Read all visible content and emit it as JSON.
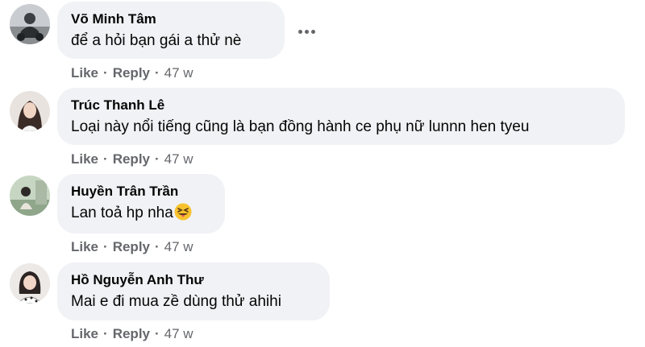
{
  "comments": [
    {
      "author": "Võ Minh Tâm",
      "text": "để a hỏi bạn gái a thử nè",
      "like": "Like",
      "reply": "Reply",
      "sep": "·",
      "time": "47 w",
      "avatar_icon": "avatar-photo-motorbike"
    },
    {
      "author": "Trúc Thanh Lê",
      "text": "Loại này nổi tiếng cũng là bạn đồng hành ce phụ nữ lunnn hen tyeu",
      "like": "Like",
      "reply": "Reply",
      "sep": "·",
      "time": "47 w",
      "avatar_icon": "avatar-photo-woman"
    },
    {
      "author": "Huyền Trân Trần",
      "text": "Lan toả hp nha",
      "emoji": "squinting-face-with-tongue-emoji",
      "like": "Like",
      "reply": "Reply",
      "sep": "·",
      "time": "47 w",
      "avatar_icon": "avatar-photo-outdoor"
    },
    {
      "author": "Hồ Nguyễn Anh Thư",
      "text": "Mai e đi mua zề dùng thử ahihi",
      "like": "Like",
      "reply": "Reply",
      "sep": "·",
      "time": "47 w",
      "avatar_icon": "avatar-photo-girl"
    }
  ],
  "more_icon": "more-options-icon",
  "colors": {
    "bubble_bg": "#f0f2f5",
    "text": "#050505",
    "meta": "#65676b"
  }
}
